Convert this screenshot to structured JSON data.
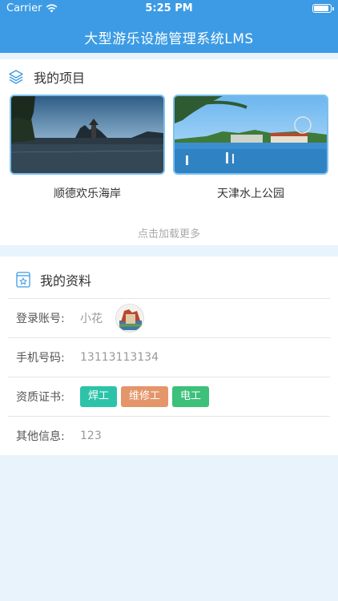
{
  "status_bar": {
    "carrier": "Carrier",
    "time": "5:25 PM",
    "battery_level": 0.9
  },
  "header": {
    "title": "大型游乐设施管理系统LMS"
  },
  "projects": {
    "heading": "我的项目",
    "icon": "layers-icon",
    "items": [
      {
        "name": "顺德欢乐海岸"
      },
      {
        "name": "天津水上公园"
      }
    ],
    "load_more": "点击加载更多"
  },
  "profile": {
    "heading": "我的资料",
    "icon": "profile-card-icon",
    "account_label": "登录账号:",
    "account_value": "小花",
    "phone_label": "手机号码:",
    "phone_value": "13113113134",
    "cert_label": "资质证书:",
    "certs": [
      {
        "label": "焊工",
        "color": "#2cc3a9"
      },
      {
        "label": "维修工",
        "color": "#e4956a"
      },
      {
        "label": "电工",
        "color": "#3cc07a"
      }
    ],
    "other_label": "其他信息:",
    "other_value": "123"
  },
  "colors": {
    "primary": "#3c9be4",
    "background": "#e8f3fc",
    "accent_border": "#7cc0ef"
  }
}
